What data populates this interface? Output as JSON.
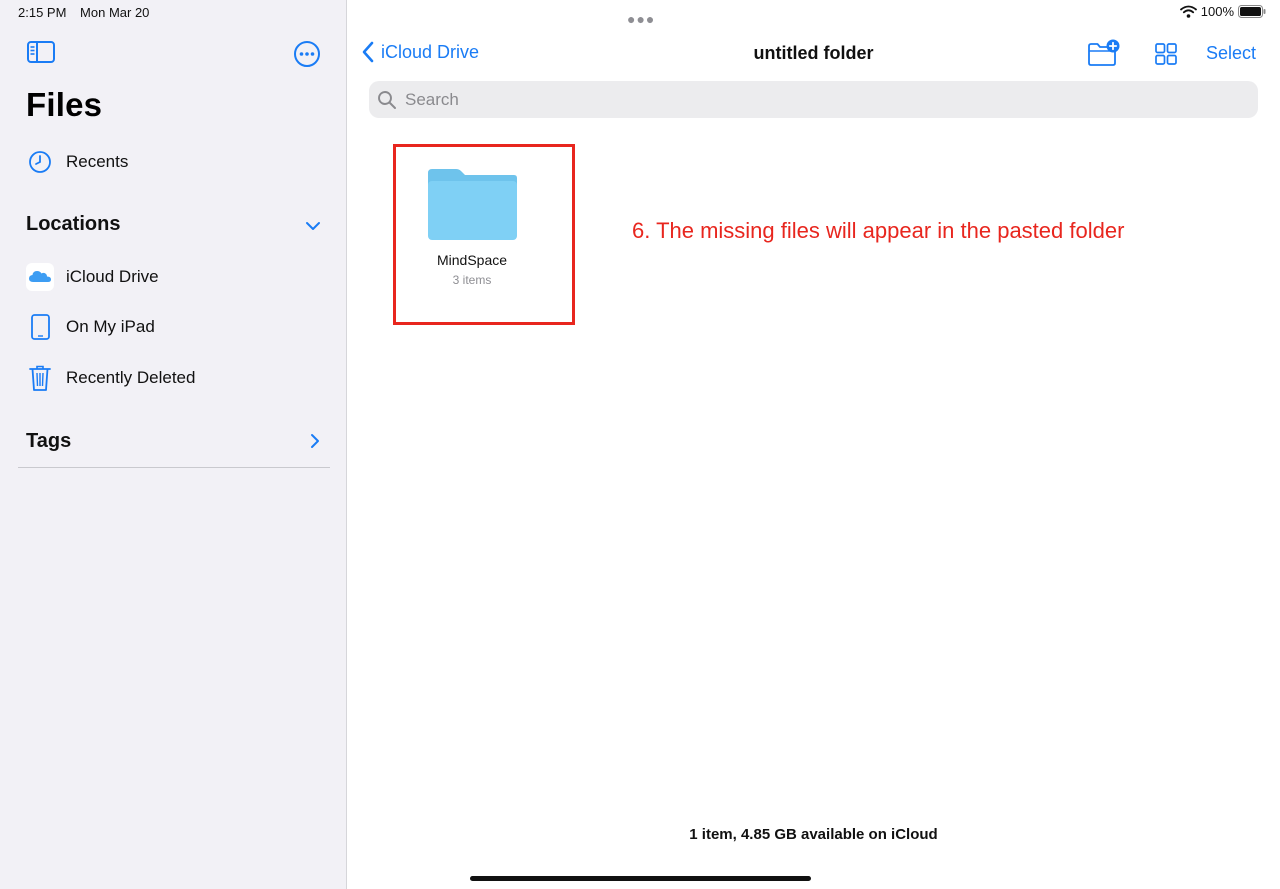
{
  "status_bar": {
    "time": "2:15 PM",
    "date": "Mon Mar 20",
    "battery_percent": "100%"
  },
  "sidebar": {
    "title": "Files",
    "recents_label": "Recents",
    "locations_heading": "Locations",
    "locations": [
      {
        "label": "iCloud Drive",
        "icon": "icloud-icon"
      },
      {
        "label": "On My iPad",
        "icon": "ipad-icon"
      },
      {
        "label": "Recently Deleted",
        "icon": "trash-icon"
      }
    ],
    "tags_heading": "Tags"
  },
  "navbar": {
    "back_label": "iCloud Drive",
    "title": "untitled folder",
    "select_label": "Select"
  },
  "search": {
    "placeholder": "Search",
    "value": ""
  },
  "items": [
    {
      "name": "MindSpace",
      "subtitle": "3 items",
      "icon": "folder-icon"
    }
  ],
  "annotation": "6. The missing files will appear in the pasted folder",
  "footer": "1 item, 4.85 GB available on iCloud",
  "colors": {
    "accent": "#1a7cf5",
    "annotation": "#e8261e",
    "folder": "#7dcdf3",
    "sidebar_bg": "#f2f1f6"
  }
}
